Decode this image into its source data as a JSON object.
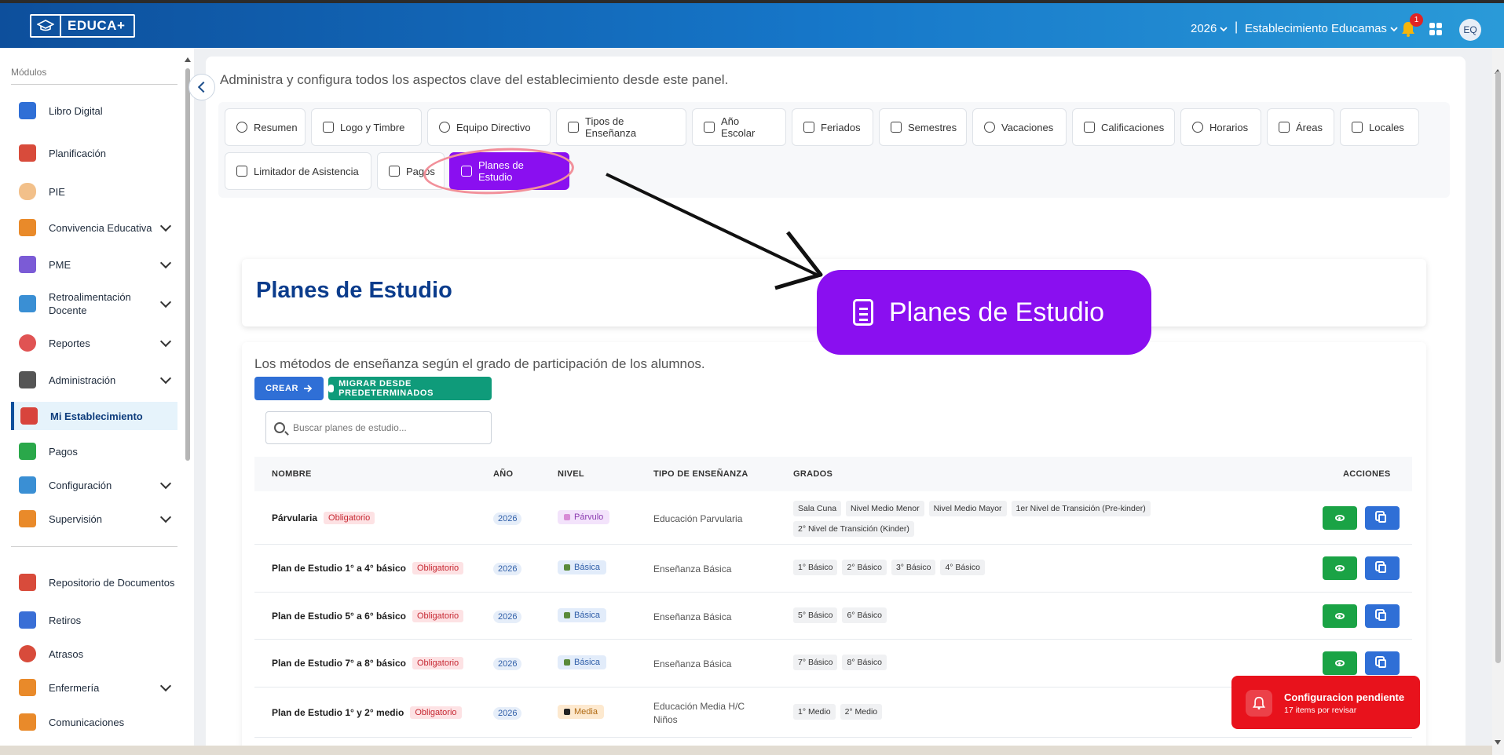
{
  "header": {
    "logo_text": "EDUCA+",
    "year": "2026",
    "separator": "|",
    "establishment": "Establecimiento Educamas",
    "notifications_count": "1",
    "avatar_initials": "EQ"
  },
  "sidebar": {
    "section_title": "Módulos",
    "items": [
      {
        "label": "Libro Digital",
        "icon": "book-icon",
        "color": "#2f6fd6"
      },
      {
        "label": "Planificación",
        "icon": "calendar-icon",
        "color": "#d84b3b"
      },
      {
        "label": "PIE",
        "icon": "hand-icon",
        "color": "#f2c08a"
      },
      {
        "label": "Convivencia Educativa",
        "icon": "people-icon",
        "color": "#e98a2a"
      },
      {
        "label": "PME",
        "icon": "chart-icon",
        "color": "#7b5bd6"
      },
      {
        "label": "Retroalimentación Docente",
        "icon": "feedback-icon",
        "color": "#3a8fd4"
      },
      {
        "label": "Reportes",
        "icon": "pie-chart-icon",
        "color": "#e05353"
      },
      {
        "label": "Administración",
        "icon": "wrench-icon",
        "color": "#555555"
      },
      {
        "label": "Mi Establecimiento",
        "icon": "school-icon",
        "color": "#d8443c"
      },
      {
        "label": "Pagos",
        "icon": "money-icon",
        "color": "#2aa84a"
      },
      {
        "label": "Configuración",
        "icon": "key-icon",
        "color": "#3a8fd4"
      },
      {
        "label": "Supervisión",
        "icon": "supervision-icon",
        "color": "#e98a2a"
      },
      {
        "label": "Repositorio de Documentos",
        "icon": "documents-icon",
        "color": "#d84b3b"
      },
      {
        "label": "Retiros",
        "icon": "exit-icon",
        "color": "#3a6fd6"
      },
      {
        "label": "Atrasos",
        "icon": "clock-icon",
        "color": "#d84b3b"
      },
      {
        "label": "Enfermería",
        "icon": "nurse-icon",
        "color": "#e98a2a"
      },
      {
        "label": "Comunicaciones",
        "icon": "megaphone-icon",
        "color": "#e98a2a"
      }
    ]
  },
  "main": {
    "subtitle": "Administra y configura todos los aspectos clave del establecimiento desde este panel.",
    "tabs": [
      {
        "label": "Resumen"
      },
      {
        "label": "Logo y Timbre"
      },
      {
        "label": "Equipo Directivo"
      },
      {
        "label": "Tipos de Enseñanza"
      },
      {
        "label": "Año Escolar"
      },
      {
        "label": "Feriados"
      },
      {
        "label": "Semestres"
      },
      {
        "label": "Vacaciones"
      },
      {
        "label": "Calificaciones"
      },
      {
        "label": "Horarios"
      },
      {
        "label": "Áreas"
      },
      {
        "label": "Locales"
      },
      {
        "label": "Limitador de Asistencia"
      },
      {
        "label": "Pagos"
      },
      {
        "label": "Planes de Estudio"
      }
    ],
    "active_tab": "Planes de Estudio",
    "page_title": "Planes de Estudio",
    "zoom_label": "Planes de Estudio",
    "description": "Los métodos de enseñanza según el grado de participación de los alumnos.",
    "btn_create": "CREAR",
    "btn_migrate": "MIGRAR DESDE PREDETERMINADOS",
    "search_placeholder": "Buscar planes de estudio...",
    "columns": [
      "NOMBRE",
      "AÑO",
      "NIVEL",
      "TIPO DE ENSEÑANZA",
      "GRADOS",
      "ACCIONES"
    ],
    "rows": [
      {
        "name": "Párvularia",
        "badge": "Obligatorio",
        "year": "2026",
        "level": "Párvulo",
        "level_color": "#f3e3fb",
        "level_text": "#8b3bb0",
        "type": "Educación Parvularia",
        "grades": [
          "Sala Cuna",
          "Nivel Medio Menor",
          "Nivel Medio Mayor",
          "1er Nivel de Transición (Pre-kinder)",
          "2° Nivel de Transición (Kinder)"
        ]
      },
      {
        "name": "Plan de Estudio 1° a 4° básico",
        "badge": "Obligatorio",
        "year": "2026",
        "level": "Básica",
        "level_color": "#e2ecfa",
        "level_text": "#2f5ea8",
        "type": "Enseñanza Básica",
        "grades": [
          "1° Básico",
          "2° Básico",
          "3° Básico",
          "4° Básico"
        ]
      },
      {
        "name": "Plan de Estudio 5° a 6° básico",
        "badge": "Obligatorio",
        "year": "2026",
        "level": "Básica",
        "level_color": "#e2ecfa",
        "level_text": "#2f5ea8",
        "type": "Enseñanza Básica",
        "grades": [
          "5° Básico",
          "6° Básico"
        ]
      },
      {
        "name": "Plan de Estudio 7° a 8° básico",
        "badge": "Obligatorio",
        "year": "2026",
        "level": "Básica",
        "level_color": "#e2ecfa",
        "level_text": "#2f5ea8",
        "type": "Enseñanza Básica",
        "grades": [
          "7° Básico",
          "8° Básico"
        ]
      },
      {
        "name": "Plan de Estudio 1° y 2° medio",
        "badge": "Obligatorio",
        "year": "2026",
        "level": "Media",
        "level_color": "#fde9cf",
        "level_text": "#b06a12",
        "type": "Educación Media H/C Niños",
        "grades": [
          "1° Medio",
          "2° Medio"
        ]
      }
    ]
  },
  "toast": {
    "title": "Configuracion pendiente",
    "subtitle": "17 items por revisar"
  }
}
